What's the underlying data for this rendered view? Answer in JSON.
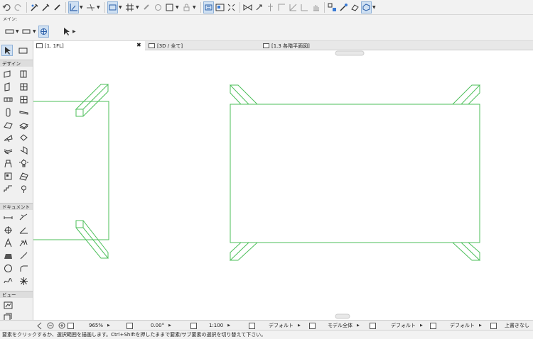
{
  "toolbar": {
    "main_label": "メイン:"
  },
  "toolbox": {
    "sections": {
      "design": "デザイン",
      "document": "ドキュメント",
      "view": "ビュー"
    }
  },
  "tabs": [
    {
      "label": "[1. 1FL]"
    },
    {
      "label": "[3D / 全て]"
    },
    {
      "label": "[1.3 各階平面図]"
    }
  ],
  "tab_close": "✖",
  "statusbar": {
    "zoom": "965%",
    "angle": "0.00°",
    "scale": "1:100",
    "layer_combo": "デフォルト",
    "model_view": "モデル全体",
    "pen_set": "デフォルト",
    "dimension": "デフォルト",
    "override": "上書きなし"
  },
  "hint": "要素をクリックするか、選択範囲を描画します。Ctrl+Shiftを押したままで要素/サブ要素の選択を切り替えて下さい。",
  "colors": {
    "wall_line": "#4cbf5a",
    "selected_bg": "#cfe0f2"
  }
}
